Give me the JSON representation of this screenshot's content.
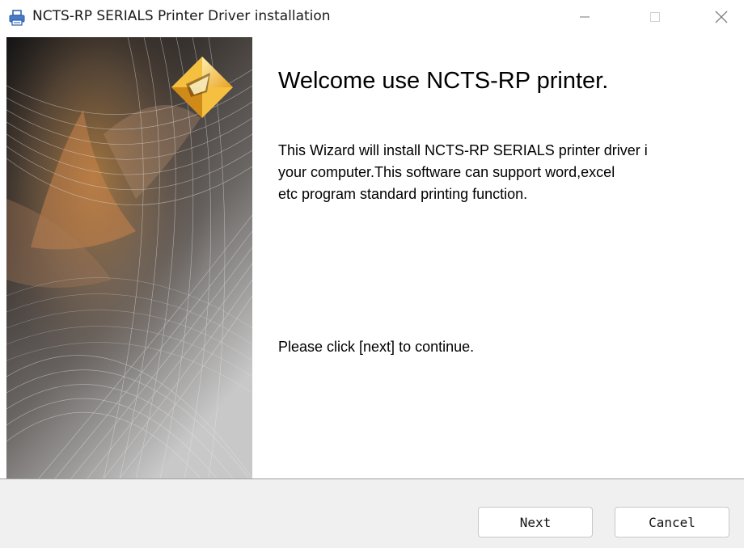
{
  "window": {
    "title": "NCTS-RP SERIALS Printer Driver installation",
    "icon": "printer-icon",
    "controls": {
      "minimize": "minimize-icon",
      "maximize": "maximize-icon",
      "close": "close-icon"
    }
  },
  "wizard": {
    "heading": "Welcome use NCTS-RP printer.",
    "description_lines": [
      "This Wizard will install NCTS-RP SERIALS printer driver i",
      "your computer.This software can support word,excel",
      "etc program standard printing function."
    ],
    "instruction": "Please click [next] to continue."
  },
  "buttons": {
    "next": "Next",
    "cancel": "Cancel"
  },
  "colors": {
    "footer_bg": "#f0f0f0",
    "logo_gold": "#f0b030",
    "banner_dark": "#1a1a1a"
  }
}
